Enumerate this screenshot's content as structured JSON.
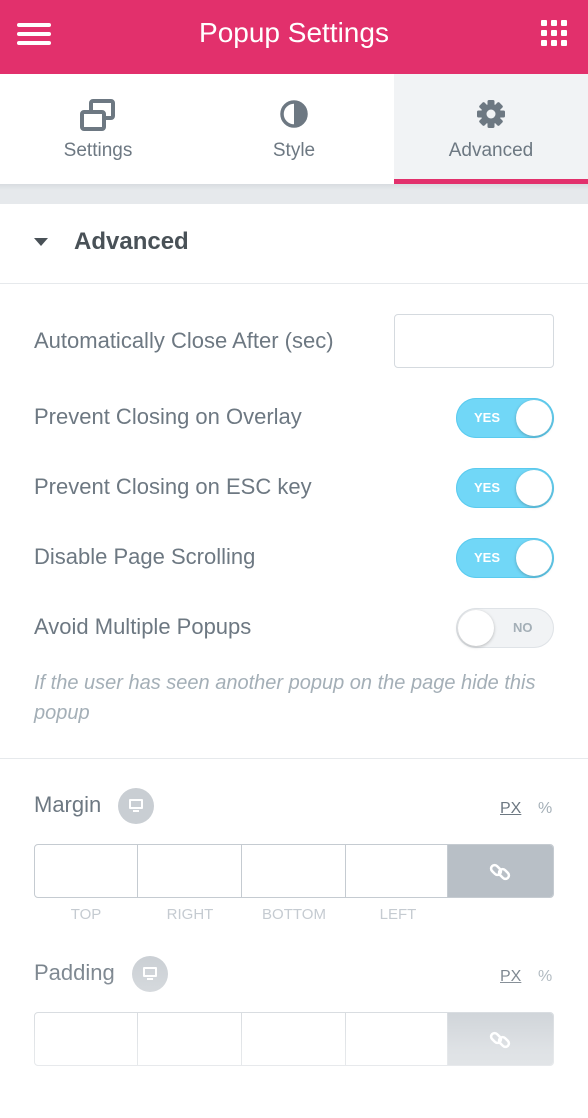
{
  "header": {
    "title": "Popup Settings",
    "menu_icon": "hamburger-icon",
    "apps_icon": "grid-apps-icon",
    "brand_color": "#e2306c"
  },
  "tabs": [
    {
      "label": "Settings",
      "icon": "windows-icon",
      "active": false
    },
    {
      "label": "Style",
      "icon": "contrast-icon",
      "active": false
    },
    {
      "label": "Advanced",
      "icon": "gear-icon",
      "active": true
    }
  ],
  "section": {
    "title": "Advanced",
    "expanded": true
  },
  "controls": {
    "auto_close": {
      "label": "Automatically Close After (sec)",
      "value": ""
    },
    "prevent_overlay": {
      "label": "Prevent Closing on Overlay",
      "state": "YES"
    },
    "prevent_esc": {
      "label": "Prevent Closing on ESC key",
      "state": "YES"
    },
    "disable_scroll": {
      "label": "Disable Page Scrolling",
      "state": "YES"
    },
    "avoid_multiple": {
      "label": "Avoid Multiple Popups",
      "state": "NO"
    },
    "avoid_multiple_hint": "If the user has seen another popup on the page hide this popup"
  },
  "margin": {
    "label": "Margin",
    "unit_px": "PX",
    "unit_pct": "%",
    "top_label": "TOP",
    "right_label": "RIGHT",
    "bottom_label": "BOTTOM",
    "left_label": "LEFT",
    "values": {
      "top": "",
      "right": "",
      "bottom": "",
      "left": ""
    }
  },
  "padding": {
    "label": "Padding",
    "unit_px": "PX",
    "unit_pct": "%",
    "values": {
      "top": "",
      "right": "",
      "bottom": "",
      "left": ""
    }
  },
  "colors": {
    "switch_on": "#71d7f7",
    "text": "#6d7882",
    "muted": "#a4afb7"
  }
}
